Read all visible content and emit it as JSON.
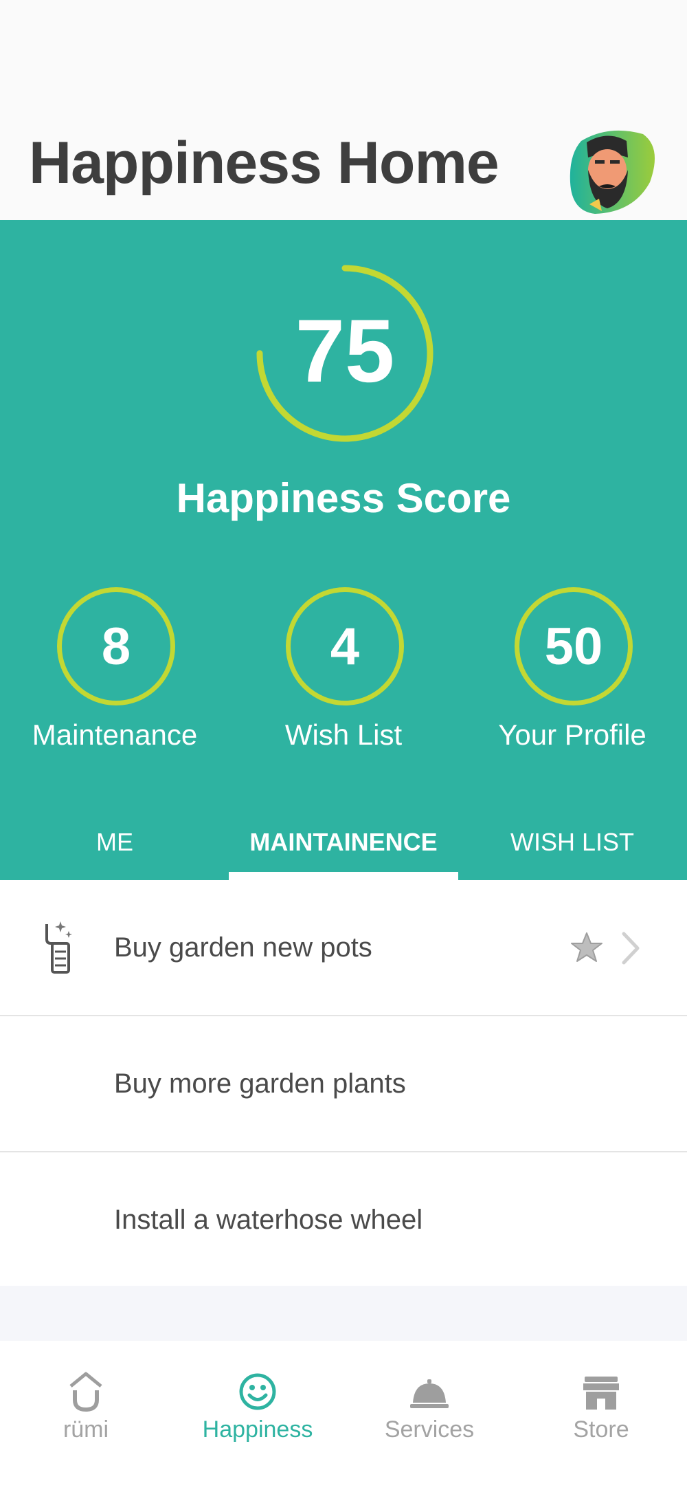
{
  "header": {
    "title": "Happiness Home"
  },
  "score": {
    "value": "75",
    "label": "Happiness Score",
    "progress": 0.75
  },
  "stats": [
    {
      "value": "8",
      "label": "Maintenance"
    },
    {
      "value": "4",
      "label": "Wish List"
    },
    {
      "value": "50",
      "label": "Your Profile"
    }
  ],
  "tabs": [
    {
      "label": "ME"
    },
    {
      "label": "MAINTAINENCE"
    },
    {
      "label": "WISH LIST"
    }
  ],
  "active_tab": "MAINTAINENCE",
  "list": [
    {
      "label": "Buy garden new pots",
      "icon": "appliance-sparkle-icon"
    },
    {
      "label": "Buy more garden plants"
    },
    {
      "label": "Install a waterhose wheel"
    }
  ],
  "tabbar": [
    {
      "label": "rümi",
      "icon": "rumi-home-icon"
    },
    {
      "label": "Happiness",
      "icon": "smiley-icon"
    },
    {
      "label": "Services",
      "icon": "service-bell-icon"
    },
    {
      "label": "Store",
      "icon": "storefront-icon"
    }
  ],
  "active_tabbar": "Happiness",
  "colors": {
    "teal": "#2eb3a1",
    "lime": "#c3d833",
    "title": "#3e3e3e",
    "inactive": "#a3a3a3"
  }
}
